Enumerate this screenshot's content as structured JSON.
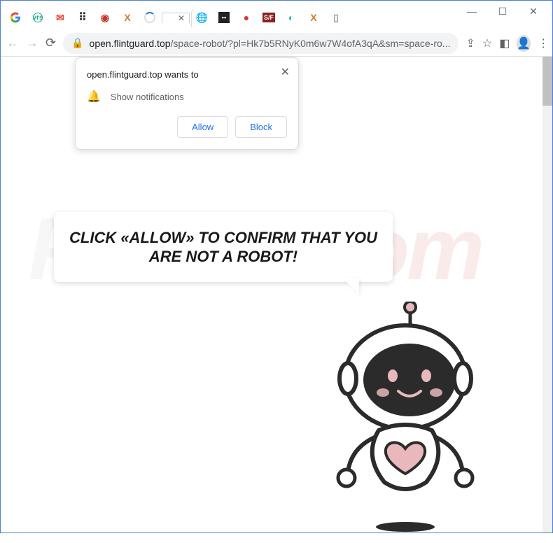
{
  "window": {
    "controls": {
      "minimize": "—",
      "maximize": "☐",
      "close": "✕"
    }
  },
  "tabs": {
    "active_close": "✕"
  },
  "addressbar": {
    "lock": "🔒",
    "domain": "open.flintguard.top",
    "path": "/space-robot/?pl=Hk7b5RNyK0m6w7W4ofA3qA&sm=space-ro..."
  },
  "permission": {
    "title": "open.flintguard.top wants to",
    "line": "Show notifications",
    "allow": "Allow",
    "block": "Block",
    "close": "✕"
  },
  "page": {
    "bubble_text": "CLICK «ALLOW» TO CONFIRM THAT YOU ARE NOT A ROBOT!"
  },
  "watermark": {
    "p1": "PC",
    "p2": "risk.com"
  }
}
